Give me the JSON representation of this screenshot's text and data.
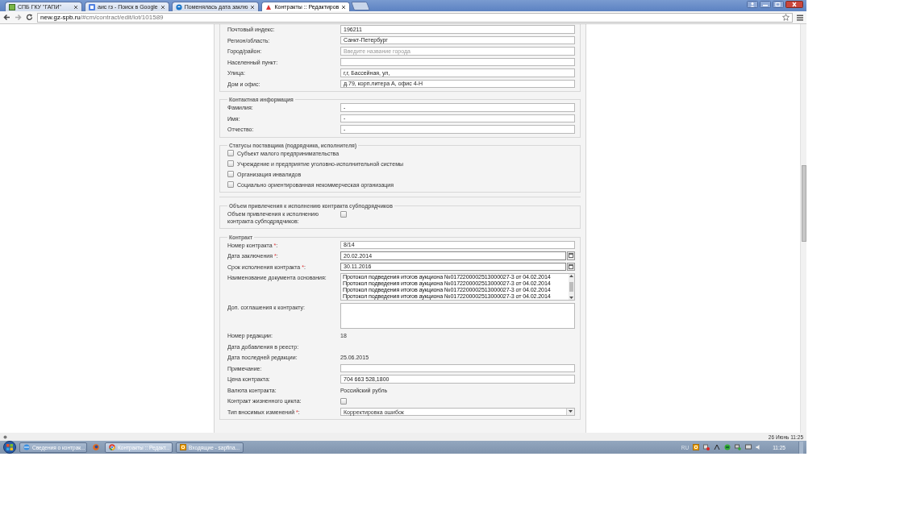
{
  "browser": {
    "tabs": [
      {
        "title": "СПБ ГКУ \"ГАПИ\"",
        "selected": false
      },
      {
        "title": "аис гз - Поиск в Google",
        "selected": false
      },
      {
        "title": "Поменялась дата заклю",
        "selected": false
      },
      {
        "title": "Контракты :: Редактиров",
        "selected": true
      }
    ],
    "url_host": "new.gz-spb.ru",
    "url_path": "/#cm/contract/edit/lot/101589"
  },
  "supplier_group": {
    "sections": [
      {
        "rows": [
          {
            "kind": "input",
            "label": "Почтовый индекс:",
            "value": "196211"
          },
          {
            "kind": "input",
            "label": "Регион/область:",
            "value": "Санкт-Петербург"
          },
          {
            "kind": "input",
            "label": "Город/район:",
            "placeholder": "Введите название города"
          },
          {
            "kind": "input",
            "label": "Населенный пункт:"
          },
          {
            "kind": "input",
            "label": "Улица:",
            "value": "г,г, Бассейная, ул,"
          },
          {
            "kind": "input",
            "label": "Дом и офис:",
            "value": "д.79, корп.литера А, офис 4-Н"
          }
        ]
      },
      {
        "legend": "Контактная информация",
        "rows": [
          {
            "kind": "input",
            "label": "Фамилия:",
            "value": "-"
          },
          {
            "kind": "input",
            "label": "Имя:",
            "value": "-"
          },
          {
            "kind": "input",
            "label": "Отчество:",
            "value": "-"
          }
        ]
      },
      {
        "legend": "Статусы поставщика (подрядчика, исполнителя)",
        "rows": [
          {
            "kind": "check",
            "label": "Субъект малого предпринимательства",
            "checked": false
          },
          {
            "kind": "check",
            "label": "Учреждение и предприятие уголовно-исполнительной системы",
            "checked": false
          },
          {
            "kind": "check",
            "label": "Организация инвалидов",
            "checked": false
          },
          {
            "kind": "check",
            "label": "Социально ориентированная некоммерческая организация",
            "checked": false
          }
        ]
      }
    ]
  },
  "sections": [
    {
      "legend": "Объем привлечения к исполнению контракта субподрядчиков",
      "rows": [
        {
          "kind": "checkbox",
          "label": "Объем привлечения к исполнению контракта субподрядчиков:",
          "checked": false
        }
      ]
    },
    {
      "legend": "Контракт",
      "rows": [
        {
          "kind": "input",
          "label": "Номер контракта",
          "required_mark": "*",
          "label_end": ":",
          "value": "8/14"
        },
        {
          "kind": "date",
          "label": "Дата заключения",
          "required_mark": "*",
          "label_end": ":",
          "value": "20.02.2014"
        },
        {
          "kind": "date",
          "label": "Срок исполнения контракта",
          "required_mark": "*",
          "label_end": ":",
          "value": "30.11.2016"
        },
        {
          "kind": "listbox",
          "label": "Наименование документа основания:",
          "lines": [
            "Протокол подведения итогов аукциона №0172200002513000027-3 от 04.02.2014",
            "Протокол подведения итогов аукциона №0172200002513000027-3 от 04.02.2014",
            "Протокол подведения итогов аукциона №0172200002513000027-3 от 04.02.2014",
            "Протокол подведения итогов аукциона №0172200002513000027-3 от 04.02.2014"
          ]
        },
        {
          "kind": "textarea",
          "label": "Доп. соглашения к контракту:"
        },
        {
          "kind": "text",
          "label": "Номер редакции:",
          "value": "18"
        },
        {
          "kind": "text",
          "label": "Дата добавления в реестр:"
        },
        {
          "kind": "text",
          "label": "Дата последней редакции:",
          "value": "25.06.2015"
        },
        {
          "kind": "input",
          "label": "Примечание:"
        },
        {
          "kind": "input",
          "label": "Цена контракта:",
          "value": "704 663 528,1800"
        },
        {
          "kind": "text",
          "label": "Валюта контракта:",
          "value": "Российский рубль"
        },
        {
          "kind": "checkbox",
          "label": "Контракт жизненного цикла:",
          "checked": false
        },
        {
          "kind": "select",
          "label": "Тип вносимых изменений",
          "required_mark": "*",
          "label_end": ":",
          "value": "Корректировка ошибок"
        }
      ]
    }
  ],
  "status_bar": {
    "datetime": "26 Июнь 11:25"
  },
  "taskbar": {
    "items": [
      {
        "kind": "window",
        "label": "Сведения о контрак...",
        "selected": false
      },
      {
        "kind": "pinned",
        "selected": false
      },
      {
        "kind": "window",
        "label": "Контракты :: Редакт...",
        "selected": true
      },
      {
        "kind": "window",
        "label": "Входящие - sapfina...",
        "selected": false
      }
    ],
    "language": "RU",
    "clock": "11:25"
  }
}
